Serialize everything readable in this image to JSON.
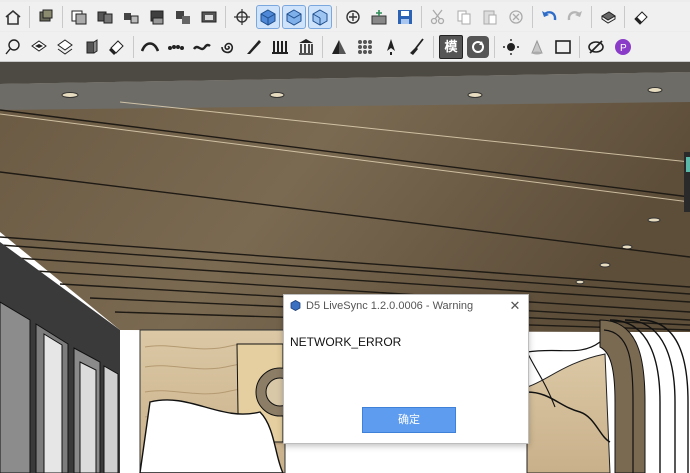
{
  "toolbar_top": {
    "icons": [
      "home-icon",
      "components-icon",
      "layers-icon",
      "materials-icon",
      "styles-icon",
      "scenes-icon",
      "shadows-icon",
      "fog-icon",
      "section-icon",
      "axes-icon",
      "iso-view-icon",
      "top-view-icon",
      "front-view-icon",
      "zoom-icon",
      "add-location-icon",
      "save-icon",
      "cut-icon",
      "copy-icon",
      "paste-icon",
      "erase-icon",
      "undo-icon",
      "redo-icon",
      "print-icon",
      "eraser-icon"
    ]
  },
  "toolbar_bottom": {
    "icons": [
      "lasso-icon",
      "select-faces-icon",
      "flip-icon",
      "extrude-icon",
      "paint-icon",
      "arc-icon",
      "dots-icon",
      "wave-icon",
      "spiral-icon",
      "knife-icon",
      "columns-icon",
      "library-icon",
      "triangle-icon",
      "grid-icon",
      "compass-icon",
      "broom-icon",
      "module-icon",
      "reload-icon",
      "target-icon",
      "cone-icon",
      "rectangle-icon",
      "hide-icon",
      "profile-icon"
    ],
    "module_glyph": "模"
  },
  "dialog": {
    "title": "D5 LiveSync 1.2.0.0006 - Warning",
    "message": "NETWORK_ERROR",
    "ok_label": "确定",
    "close_glyph": "✕",
    "accent": "#5e9cf0"
  }
}
